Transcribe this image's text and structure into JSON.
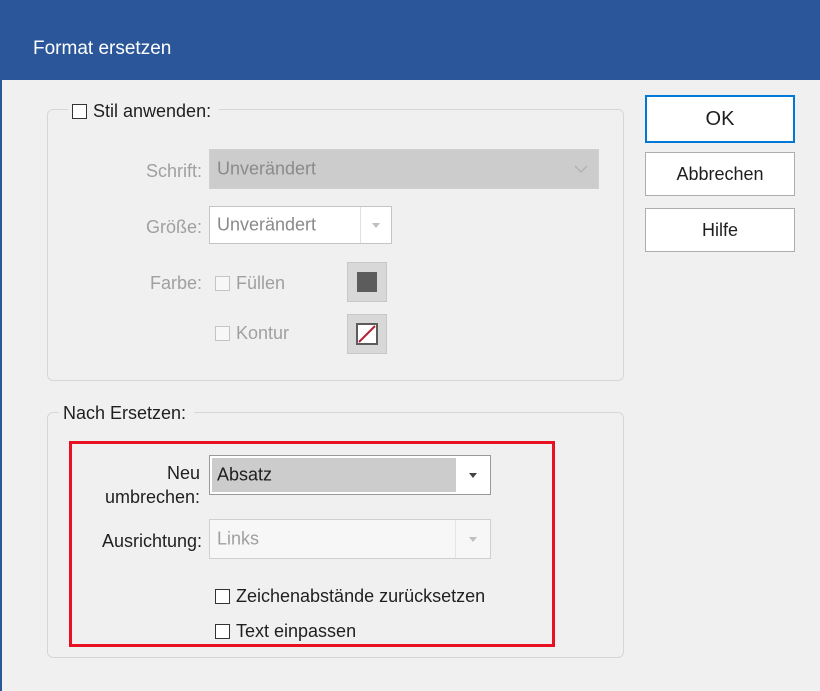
{
  "window": {
    "title": "Format ersetzen"
  },
  "apply_style": {
    "checkbox_label": "Stil anwenden:",
    "checked": false,
    "font_label": "Schrift:",
    "font_value": "Unverändert",
    "size_label": "Größe:",
    "size_value": "Unverändert",
    "color_label": "Farbe:",
    "fill_label": "Füllen",
    "stroke_label": "Kontur"
  },
  "after_replace": {
    "legend": "Nach Ersetzen:",
    "rewrap_label_line1": "Neu",
    "rewrap_label_line2": "umbrechen:",
    "rewrap_value": "Absatz",
    "align_label": "Ausrichtung:",
    "align_value": "Links",
    "reset_spacing_label": "Zeichenabstände zurücksetzen",
    "fit_text_label": "Text einpassen"
  },
  "buttons": {
    "ok": "OK",
    "cancel": "Abbrechen",
    "help": "Hilfe"
  },
  "colors": {
    "titlebar": "#2b579a",
    "highlight": "#e81123",
    "default_button_border": "#0078d7"
  }
}
